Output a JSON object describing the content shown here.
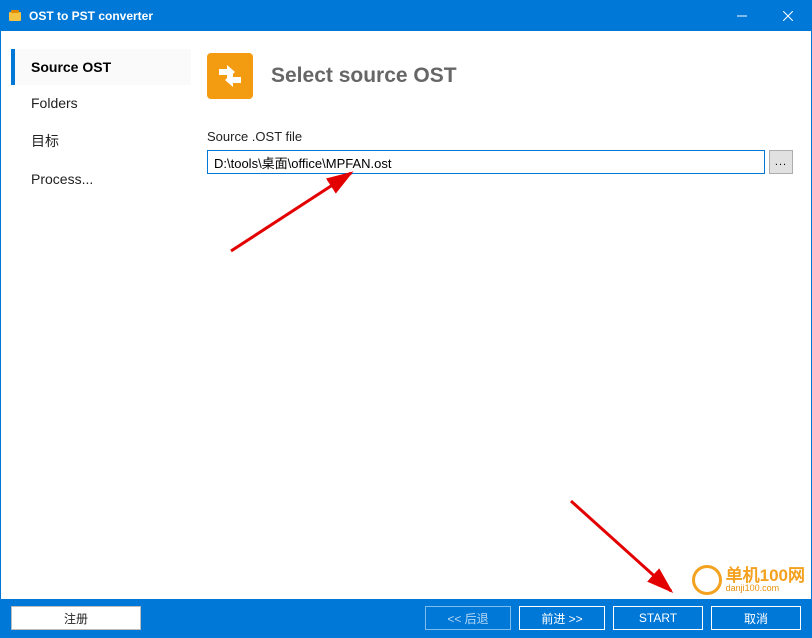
{
  "titlebar": {
    "title": "OST to PST converter"
  },
  "sidebar": {
    "items": [
      {
        "label": "Source OST",
        "active": true
      },
      {
        "label": "Folders",
        "active": false
      },
      {
        "label": "目标",
        "active": false
      },
      {
        "label": "Process...",
        "active": false
      }
    ]
  },
  "main": {
    "heading": "Select source OST",
    "field_label": "Source .OST file",
    "path_value": "D:\\tools\\桌面\\office\\MPFAN.ost",
    "browse_label": "..."
  },
  "footer": {
    "register": "注册",
    "back": "<< 后退",
    "next": "前进 >>",
    "start": "START",
    "cancel": "取消"
  },
  "watermark": {
    "cn": "单机100网",
    "en": "danji100.com"
  }
}
